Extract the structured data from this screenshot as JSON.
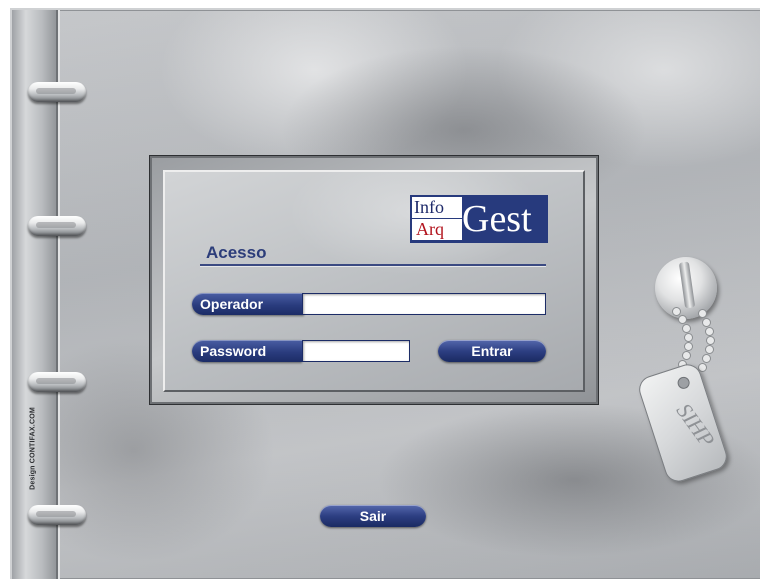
{
  "login": {
    "heading": "Acesso",
    "operador_label": "Operador",
    "operador_value": "",
    "password_label": "Password",
    "password_value": "",
    "entrar_label": "Entrar"
  },
  "logo": {
    "info": "Info",
    "arq": "Arq",
    "gest": "Gest"
  },
  "footer": {
    "sair_label": "Sair"
  },
  "credit": "Design CONTIFAX.COM",
  "keytag": {
    "text": "SIHP"
  },
  "colors": {
    "accent_blue": "#2a3c7e",
    "logo_red": "#b2121c",
    "metal": "#b8bbbe"
  },
  "icons": [
    "binder-ring-icon",
    "lock-icon",
    "key-tag-icon"
  ]
}
